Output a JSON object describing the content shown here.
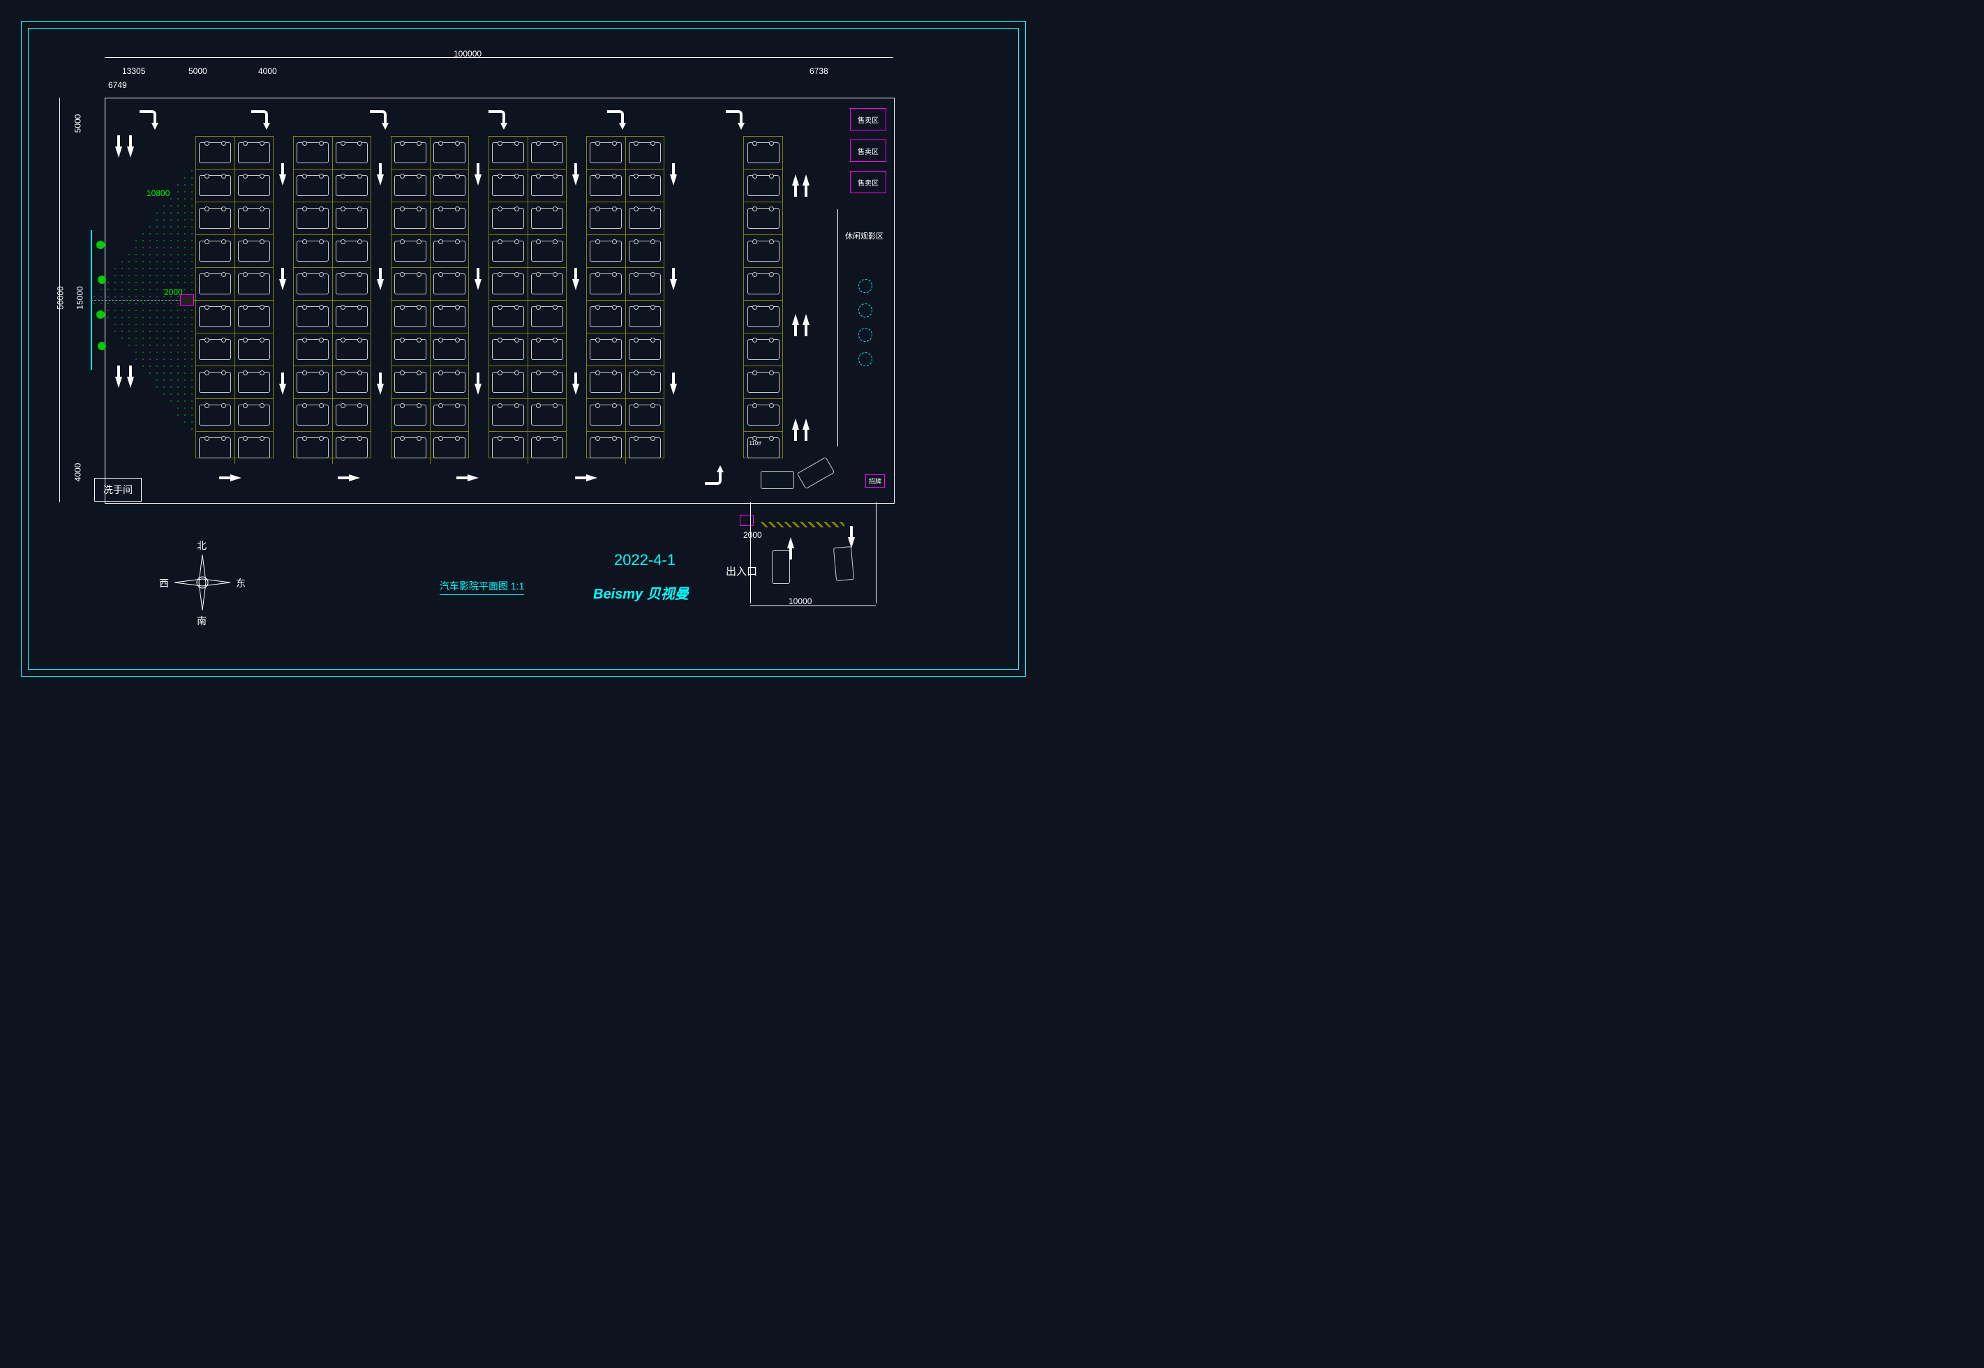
{
  "dimensions": {
    "total_width": "100000",
    "total_height": "50000",
    "left_margin": "6749",
    "screen_width": "13305",
    "parking_width": "5000",
    "aisle_width": "4000",
    "right_margin": "6738",
    "top_space": "5000",
    "mid_space": "15000",
    "bottom_space": "4000",
    "screen_diag": "10800",
    "projector_gap": "2000",
    "gate_width": "2000",
    "entrance_width": "10000"
  },
  "labels": {
    "restroom": "冼手间",
    "sales_area": "售卖区",
    "leisure_viewing": "休闲观影区",
    "signboard": "招牌",
    "entrance": "出入口",
    "parking_number": "110#"
  },
  "title": "汽车影院平面图 1:1",
  "date": "2022-4-1",
  "brand": "Beismy 贝视曼",
  "compass": {
    "n": "北",
    "s": "南",
    "e": "东",
    "w": "西"
  },
  "parking": {
    "blocks": 5,
    "rows_per_block": 10,
    "cars_per_row": 2,
    "single_block_cars": 1
  }
}
